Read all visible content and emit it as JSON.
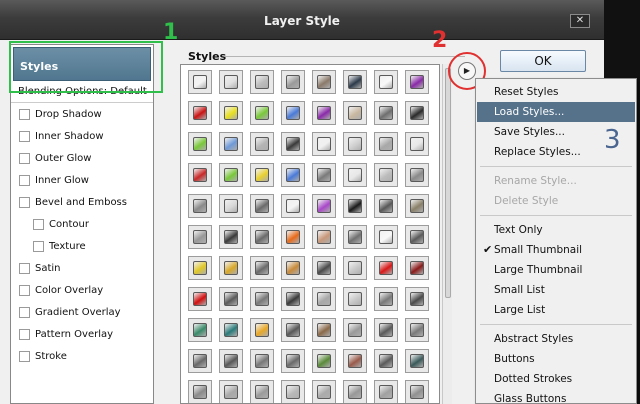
{
  "window": {
    "title": "Layer Style",
    "close_label": "✕"
  },
  "sidebar": {
    "header": "Styles",
    "blending": "Blending Options: Default",
    "items": [
      {
        "label": "Drop Shadow",
        "indent": false
      },
      {
        "label": "Inner Shadow",
        "indent": false
      },
      {
        "label": "Outer Glow",
        "indent": false
      },
      {
        "label": "Inner Glow",
        "indent": false
      },
      {
        "label": "Bevel and Emboss",
        "indent": false
      },
      {
        "label": "Contour",
        "indent": true
      },
      {
        "label": "Texture",
        "indent": true
      },
      {
        "label": "Satin",
        "indent": false
      },
      {
        "label": "Color Overlay",
        "indent": false
      },
      {
        "label": "Gradient Overlay",
        "indent": false
      },
      {
        "label": "Pattern Overlay",
        "indent": false
      },
      {
        "label": "Stroke",
        "indent": false
      }
    ]
  },
  "styles_panel": {
    "label": "Styles"
  },
  "ok_label": "OK",
  "menu_button_glyph": "▶",
  "annotations": {
    "one": "1",
    "two": "2",
    "three": "3"
  },
  "colors": {
    "highlight": "#55728a",
    "green_annotation": "#2fbf4a",
    "red_annotation": "#e03030",
    "number3": "#4a6690"
  },
  "menu": {
    "items": [
      {
        "label": "Reset Styles",
        "state": "normal"
      },
      {
        "label": "Load Styles...",
        "state": "highlighted"
      },
      {
        "label": "Save Styles...",
        "state": "normal"
      },
      {
        "label": "Replace Styles...",
        "state": "normal"
      },
      {
        "sep": true
      },
      {
        "label": "Rename Style...",
        "state": "disabled"
      },
      {
        "label": "Delete Style",
        "state": "disabled"
      },
      {
        "sep": true
      },
      {
        "label": "Text Only",
        "state": "normal"
      },
      {
        "label": "Small Thumbnail",
        "state": "checked"
      },
      {
        "label": "Large Thumbnail",
        "state": "normal"
      },
      {
        "label": "Small List",
        "state": "normal"
      },
      {
        "label": "Large List",
        "state": "normal"
      },
      {
        "sep": true
      },
      {
        "label": "Abstract Styles",
        "state": "normal"
      },
      {
        "label": "Buttons",
        "state": "normal"
      },
      {
        "label": "Dotted Strokes",
        "state": "normal"
      },
      {
        "label": "Glass Buttons",
        "state": "normal"
      }
    ]
  },
  "swatches": [
    [
      "#f4f4f4",
      "#e0e0e0",
      "#bcbcbc",
      "#9a9a9a",
      "#8a7a6a",
      "#2c3a4a",
      "#f8f8f8",
      "#8a2aa8"
    ],
    [
      "#c81414",
      "#e8e020",
      "#7ac83a",
      "#4a7ad8",
      "#8a2aa8",
      "#c8b8a0",
      "#6e6e6e",
      "#2a2a2a"
    ],
    [
      "#7ac83a",
      "#6e9ad8",
      "#b4b4b4",
      "#3a3a3a",
      "#f0f0f0",
      "#d0d0d0",
      "#a8a8a8",
      "#e8e8e8"
    ],
    [
      "#c82828",
      "#7ac83a",
      "#e8d030",
      "#4a7ad8",
      "#7a7a7a",
      "#e8e8e8",
      "#bcbcbc",
      "#8a8a8a"
    ],
    [
      "#8a8a8a",
      "#d8d8d8",
      "#6a6a6a",
      "#f4f4f4",
      "#a848c8",
      "#1a1a1a",
      "#585858",
      "#8a8068"
    ],
    [
      "#989898",
      "#3a3a3a",
      "#6a6a6a",
      "#e86a1a",
      "#c8987a",
      "#707070",
      "#f8f8f8",
      "#5a5a5a"
    ],
    [
      "#e0c828",
      "#d8a828",
      "#6a6a6a",
      "#c88a3a",
      "#4a4a4a",
      "#c8c8c8",
      "#d81818",
      "#8a1a1a"
    ],
    [
      "#d01010",
      "#5a5a5a",
      "#787878",
      "#3a3a3a",
      "#a8a8a8",
      "#c8c8c8",
      "#7a7a7a",
      "#4a4a4a"
    ],
    [
      "#3a8a6a",
      "#2a7a7a",
      "#e8a828",
      "#585858",
      "#8a6a4a",
      "#9a9a9a",
      "#5a5a5a",
      "#7a7a7a"
    ],
    [
      "#686868",
      "#585858",
      "#787878",
      "#6a6a6a",
      "#5a8a3a",
      "#9a5a4a",
      "#5a5a5a",
      "#3a5a5a"
    ],
    [
      "#8a8a8a",
      "#a8a8a8",
      "#9a9a9a",
      "#b8b8b8",
      "#aaaaaa",
      "#989898",
      "#a0a0a0",
      "#909090"
    ]
  ]
}
